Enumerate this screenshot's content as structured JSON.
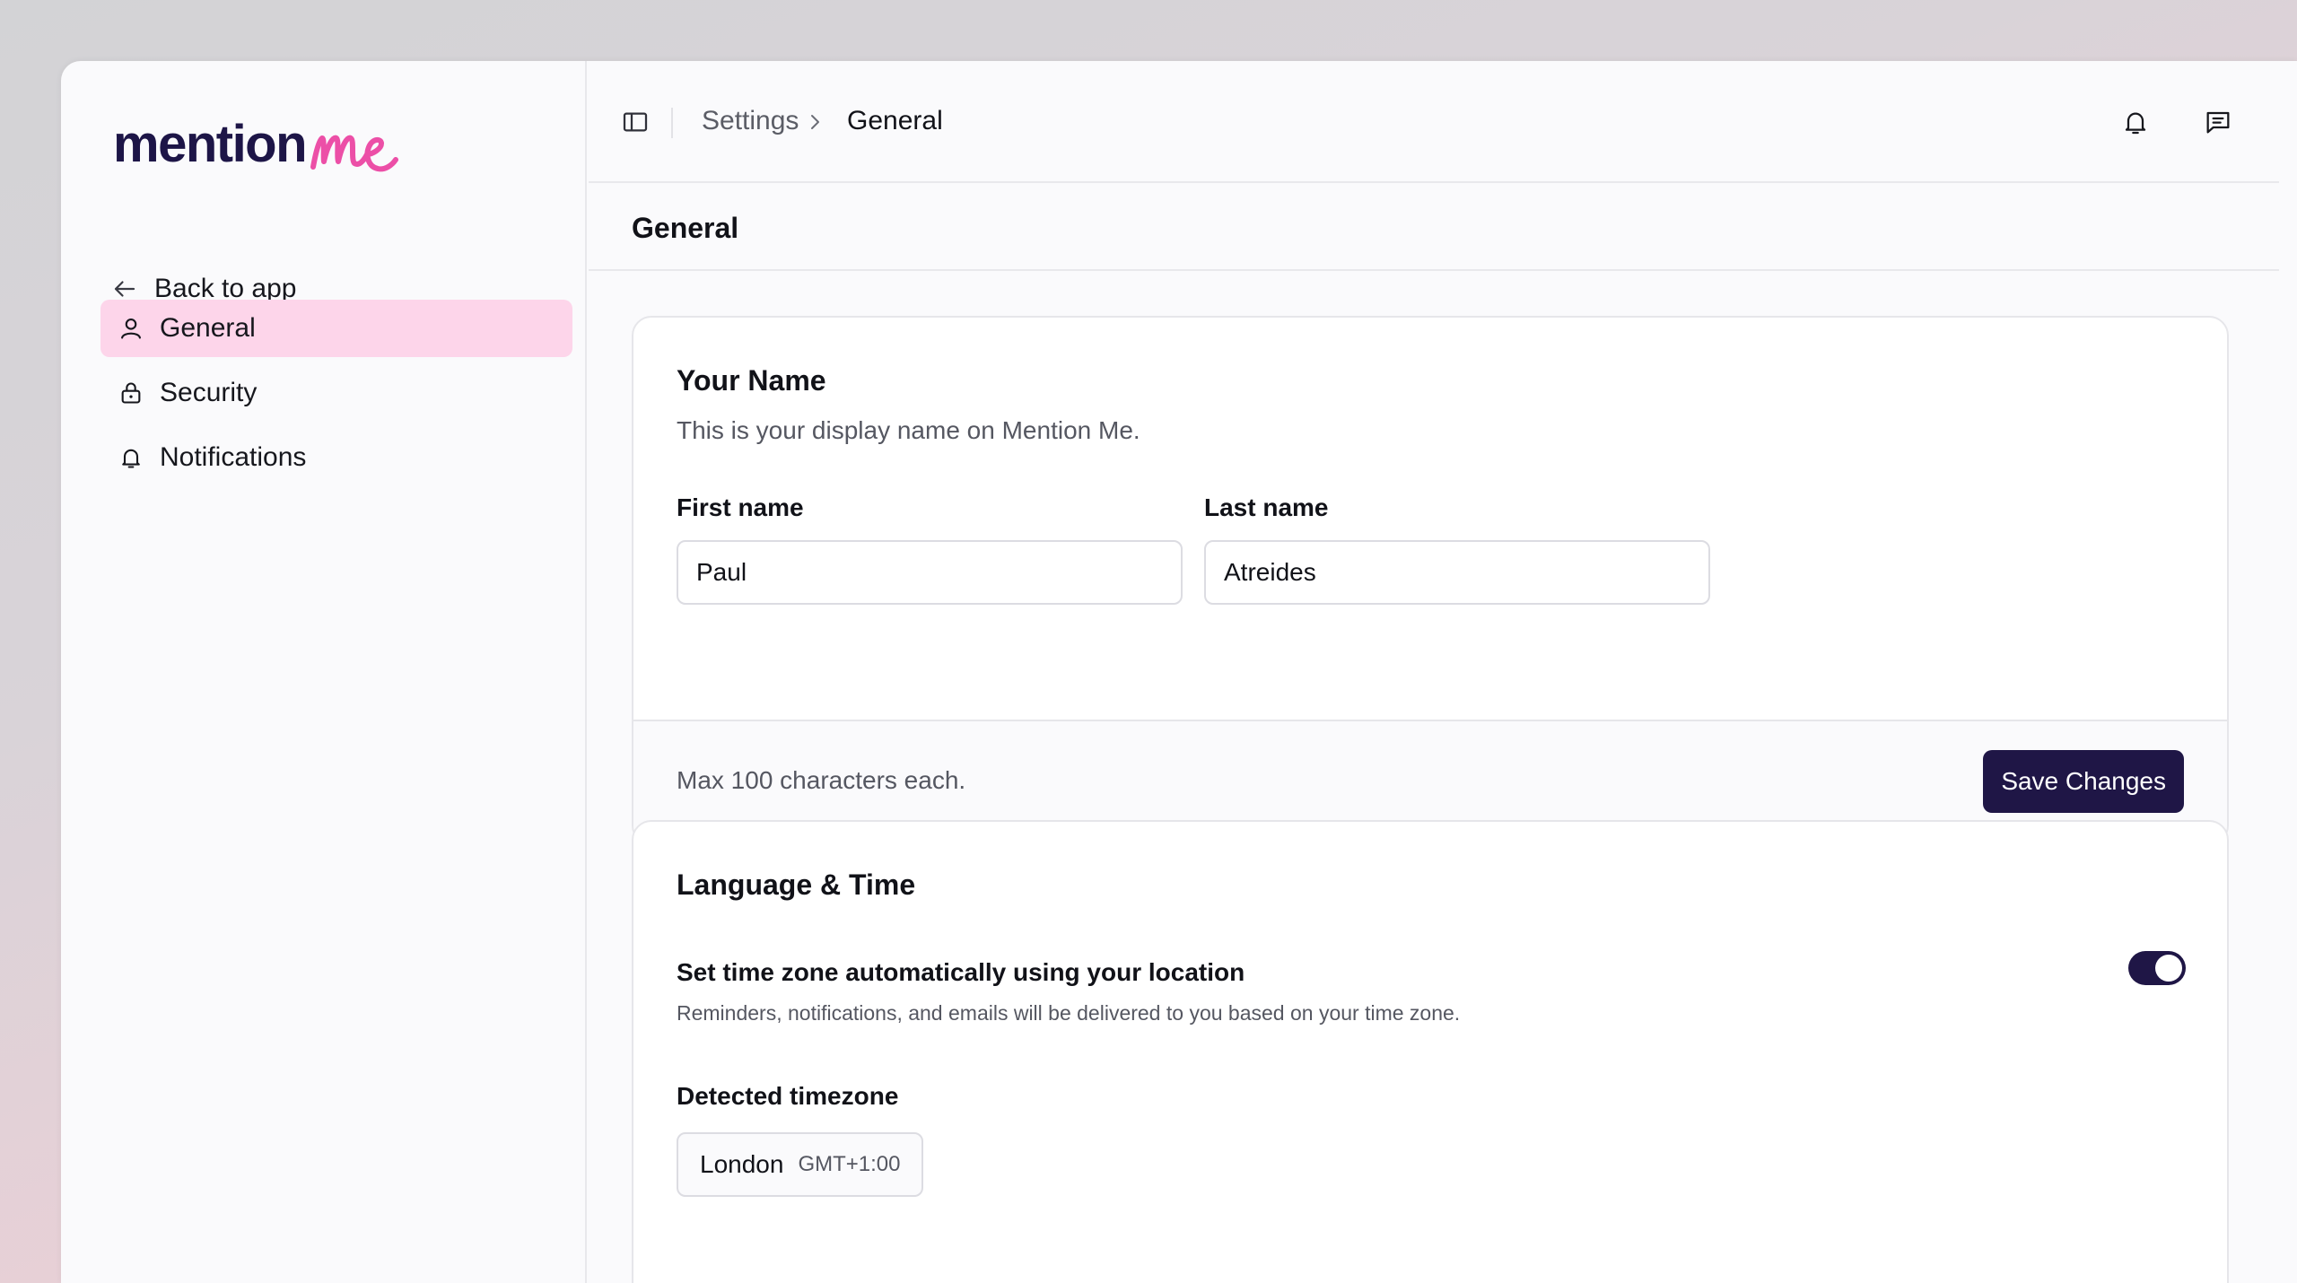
{
  "brand": {
    "name_part1": "mention",
    "name_part2": "me",
    "accent": "#ec4fa7",
    "primary": "#1f1646"
  },
  "sidebar": {
    "back_label": "Back to app",
    "items": [
      {
        "label": "General",
        "icon": "user-icon",
        "active": true
      },
      {
        "label": "Security",
        "icon": "lock-icon",
        "active": false
      },
      {
        "label": "Notifications",
        "icon": "bell-icon",
        "active": false
      }
    ]
  },
  "header": {
    "breadcrumb": [
      "Settings",
      "General"
    ],
    "icons": [
      "sidebar-toggle-icon",
      "bell-icon",
      "message-icon"
    ]
  },
  "page": {
    "title": "General"
  },
  "name_card": {
    "title": "Your Name",
    "description": "This is your display name on Mention Me.",
    "first_name_label": "First name",
    "first_name_value": "Paul",
    "last_name_label": "Last name",
    "last_name_value": "Atreides",
    "footer_note": "Max 100 characters each.",
    "save_label": "Save Changes"
  },
  "language_card": {
    "title": "Language & Time",
    "auto_tz_title": "Set time zone automatically using your location",
    "auto_tz_desc": "Reminders, notifications, and emails will be delivered to you based on your time zone.",
    "auto_tz_enabled": true,
    "detected_label": "Detected timezone",
    "timezone_city": "London",
    "timezone_offset": "GMT+1:00"
  }
}
